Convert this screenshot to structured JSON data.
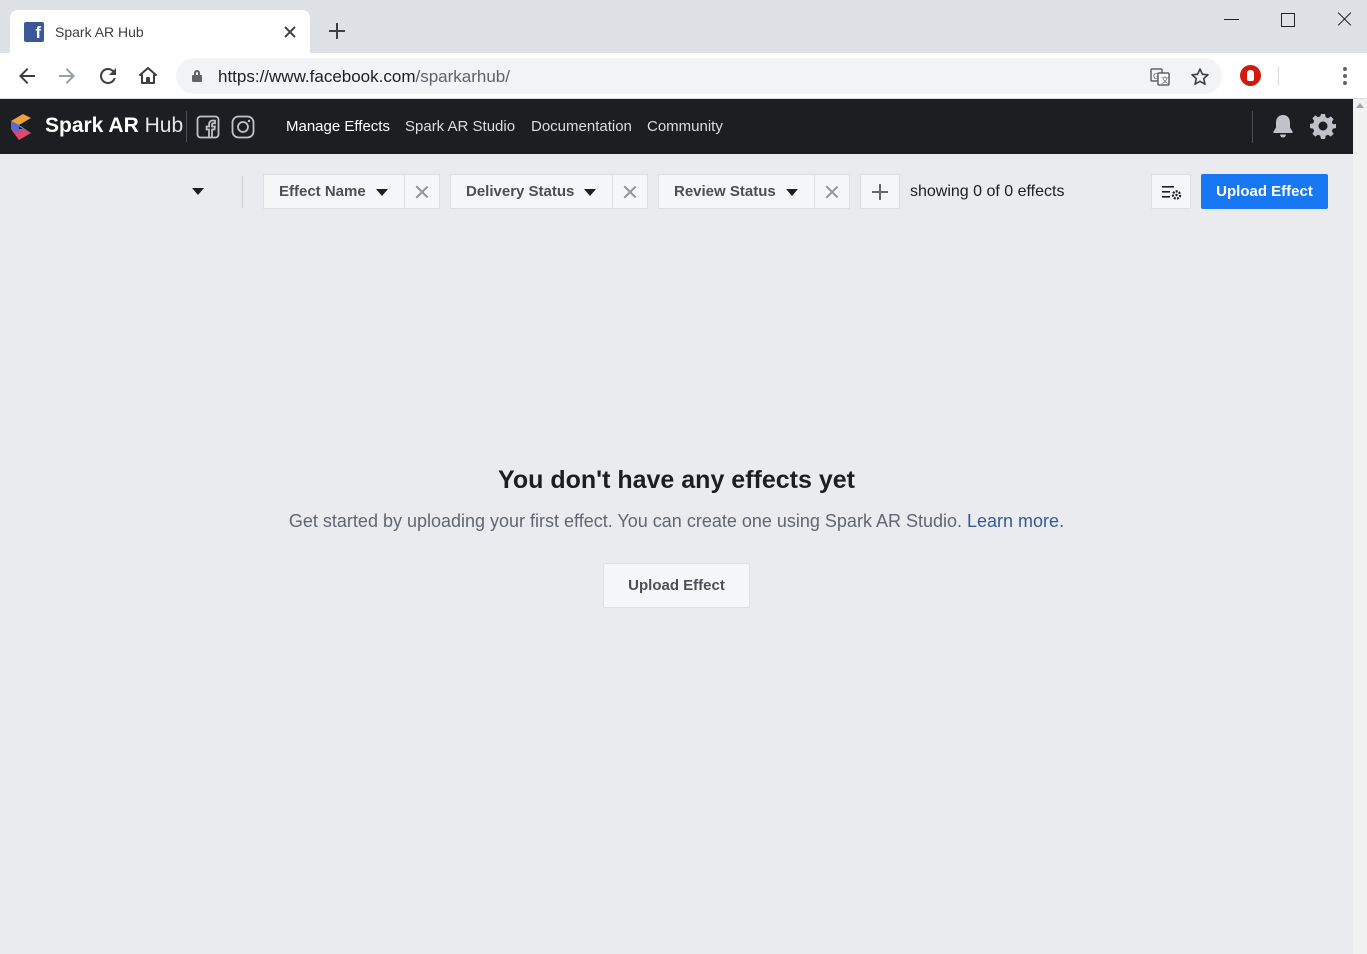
{
  "browser": {
    "tab_title": "Spark AR Hub",
    "url_host": "https://www.facebook.com",
    "url_path": "/sparkarhub/"
  },
  "header": {
    "brand_bold": "Spark AR",
    "brand_light": "Hub",
    "nav": [
      {
        "label": "Manage Effects"
      },
      {
        "label": "Spark AR Studio"
      },
      {
        "label": "Documentation"
      },
      {
        "label": "Community"
      }
    ]
  },
  "filters": {
    "pills": [
      {
        "label": "Effect Name"
      },
      {
        "label": "Delivery Status"
      },
      {
        "label": "Review Status"
      }
    ],
    "showing_text": "showing 0 of 0 effects",
    "upload_label": "Upload Effect"
  },
  "empty_state": {
    "title": "You don't have any effects yet",
    "description": "Get started by uploading your first effect. You can create one using Spark AR Studio.",
    "link": "Learn more.",
    "button_label": "Upload Effect"
  },
  "colors": {
    "header_bg": "#1c1e21",
    "page_bg": "#e9ebee",
    "primary_button": "#1877f2",
    "link": "#365899"
  },
  "icons": [
    "facebook-favicon",
    "back-arrow-icon",
    "forward-arrow-icon",
    "reload-icon",
    "home-icon",
    "lock-icon",
    "translate-icon",
    "star-icon",
    "adblock-stop-icon",
    "kebab-menu-icon",
    "spark-ar-logo",
    "facebook-icon",
    "instagram-icon",
    "bell-icon",
    "gear-icon",
    "column-settings-icon"
  ]
}
